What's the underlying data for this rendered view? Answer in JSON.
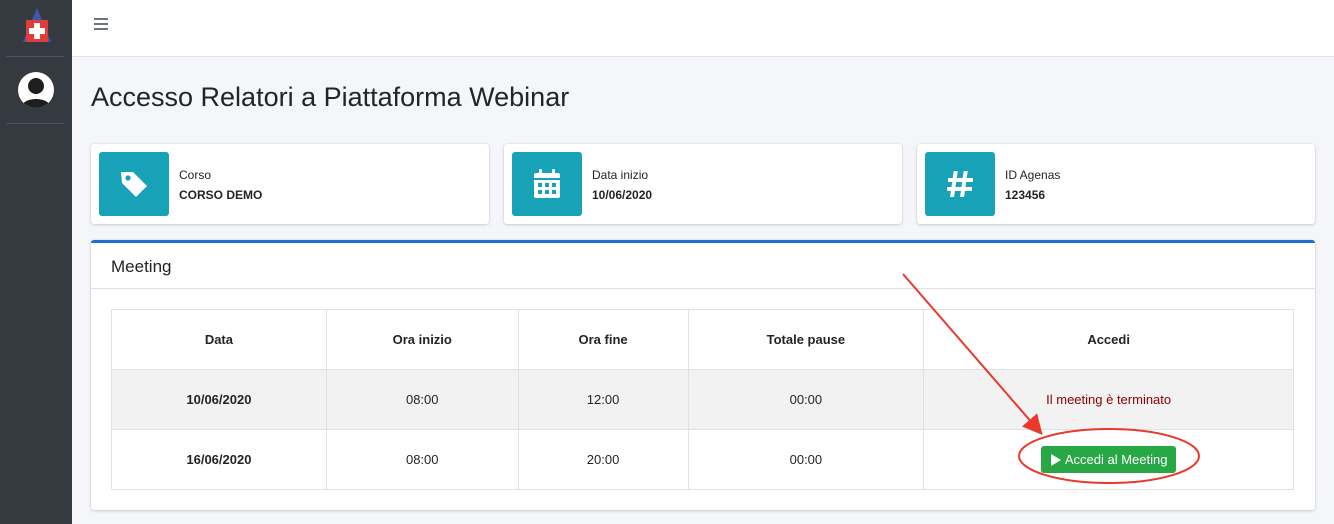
{
  "page": {
    "title": "Accesso Relatori a Piattaforma Webinar"
  },
  "info_boxes": [
    {
      "label": "Corso",
      "value": "CORSO DEMO",
      "icon": "tag-icon"
    },
    {
      "label": "Data inizio",
      "value": "10/06/2020",
      "icon": "calendar-icon"
    },
    {
      "label": "ID Agenas",
      "value": "123456",
      "icon": "hashtag-icon"
    }
  ],
  "meeting": {
    "title": "Meeting",
    "headers": [
      "Data",
      "Ora inizio",
      "Ora fine",
      "Totale pause",
      "Accedi"
    ],
    "rows": [
      {
        "data": "10/06/2020",
        "ora_inizio": "08:00",
        "ora_fine": "12:00",
        "totale_pause": "00:00",
        "accedi": "Il meeting è terminato"
      },
      {
        "data": "16/06/2020",
        "ora_inizio": "08:00",
        "ora_fine": "20:00",
        "totale_pause": "00:00",
        "accedi": "Accedi al Meeting"
      }
    ]
  },
  "colors": {
    "sidebar": "#343a40",
    "info_icon_bg": "#17a2b8",
    "card_accent": "#1f6fd1",
    "button_green": "#28a745",
    "ended_text": "#8b0000",
    "annotation_red": "#e8392b"
  }
}
